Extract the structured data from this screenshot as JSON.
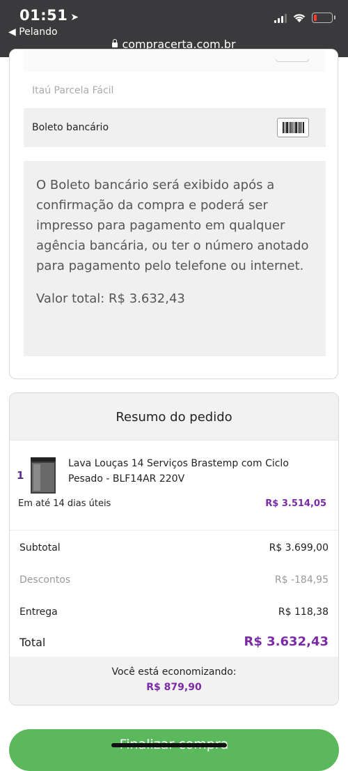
{
  "status_bar": {
    "time": "01:51",
    "back_app": "◀ Pelando",
    "url": "compracerta.com.br"
  },
  "payment": {
    "option_itau": "Itaú Parcela Fácil",
    "option_boleto": "Boleto bancário",
    "boleto_message": "O Boleto bancário será exibido após a confirmação da compra e poderá ser impresso para pagamento em qualquer agência bancária, ou ter o número anotado para pagamento pelo telefone ou internet.",
    "boleto_total": "Valor total: R$ 3.632,43"
  },
  "summary": {
    "title": "Resumo do pedido",
    "item": {
      "qty": "1",
      "name": "Lava Louças 14 Serviços Brastemp com Ciclo Pesado - BLF14AR 220V",
      "delivery": "Em até 14 dias úteis",
      "price": "R$ 3.514,05"
    },
    "subtotal_label": "Subtotal",
    "subtotal_value": "R$ 3.699,00",
    "discount_label": "Descontos",
    "discount_value": "R$ -184,95",
    "shipping_label": "Entrega",
    "shipping_value": "R$ 118,38",
    "total_label": "Total",
    "total_value": "R$ 3.632,43",
    "saving_label": "Você está economizando:",
    "saving_value": "R$ 879,90"
  },
  "finalize_label": "Finalizar compra",
  "colors": {
    "accent": "#7b2aa6",
    "button": "#5cb85c",
    "status_bar": "#3a3a3c"
  }
}
